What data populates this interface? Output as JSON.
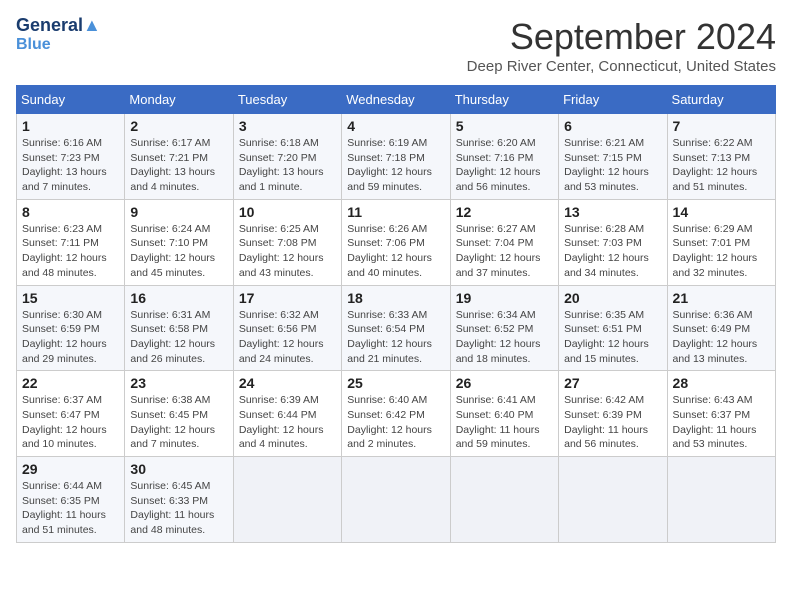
{
  "header": {
    "logo_line1": "General",
    "logo_line2": "Blue",
    "month_title": "September 2024",
    "location": "Deep River Center, Connecticut, United States"
  },
  "weekdays": [
    "Sunday",
    "Monday",
    "Tuesday",
    "Wednesday",
    "Thursday",
    "Friday",
    "Saturday"
  ],
  "weeks": [
    [
      {
        "day": 1,
        "lines": [
          "Sunrise: 6:16 AM",
          "Sunset: 7:23 PM",
          "Daylight: 13 hours",
          "and 7 minutes."
        ]
      },
      {
        "day": 2,
        "lines": [
          "Sunrise: 6:17 AM",
          "Sunset: 7:21 PM",
          "Daylight: 13 hours",
          "and 4 minutes."
        ]
      },
      {
        "day": 3,
        "lines": [
          "Sunrise: 6:18 AM",
          "Sunset: 7:20 PM",
          "Daylight: 13 hours",
          "and 1 minute."
        ]
      },
      {
        "day": 4,
        "lines": [
          "Sunrise: 6:19 AM",
          "Sunset: 7:18 PM",
          "Daylight: 12 hours",
          "and 59 minutes."
        ]
      },
      {
        "day": 5,
        "lines": [
          "Sunrise: 6:20 AM",
          "Sunset: 7:16 PM",
          "Daylight: 12 hours",
          "and 56 minutes."
        ]
      },
      {
        "day": 6,
        "lines": [
          "Sunrise: 6:21 AM",
          "Sunset: 7:15 PM",
          "Daylight: 12 hours",
          "and 53 minutes."
        ]
      },
      {
        "day": 7,
        "lines": [
          "Sunrise: 6:22 AM",
          "Sunset: 7:13 PM",
          "Daylight: 12 hours",
          "and 51 minutes."
        ]
      }
    ],
    [
      {
        "day": 8,
        "lines": [
          "Sunrise: 6:23 AM",
          "Sunset: 7:11 PM",
          "Daylight: 12 hours",
          "and 48 minutes."
        ]
      },
      {
        "day": 9,
        "lines": [
          "Sunrise: 6:24 AM",
          "Sunset: 7:10 PM",
          "Daylight: 12 hours",
          "and 45 minutes."
        ]
      },
      {
        "day": 10,
        "lines": [
          "Sunrise: 6:25 AM",
          "Sunset: 7:08 PM",
          "Daylight: 12 hours",
          "and 43 minutes."
        ]
      },
      {
        "day": 11,
        "lines": [
          "Sunrise: 6:26 AM",
          "Sunset: 7:06 PM",
          "Daylight: 12 hours",
          "and 40 minutes."
        ]
      },
      {
        "day": 12,
        "lines": [
          "Sunrise: 6:27 AM",
          "Sunset: 7:04 PM",
          "Daylight: 12 hours",
          "and 37 minutes."
        ]
      },
      {
        "day": 13,
        "lines": [
          "Sunrise: 6:28 AM",
          "Sunset: 7:03 PM",
          "Daylight: 12 hours",
          "and 34 minutes."
        ]
      },
      {
        "day": 14,
        "lines": [
          "Sunrise: 6:29 AM",
          "Sunset: 7:01 PM",
          "Daylight: 12 hours",
          "and 32 minutes."
        ]
      }
    ],
    [
      {
        "day": 15,
        "lines": [
          "Sunrise: 6:30 AM",
          "Sunset: 6:59 PM",
          "Daylight: 12 hours",
          "and 29 minutes."
        ]
      },
      {
        "day": 16,
        "lines": [
          "Sunrise: 6:31 AM",
          "Sunset: 6:58 PM",
          "Daylight: 12 hours",
          "and 26 minutes."
        ]
      },
      {
        "day": 17,
        "lines": [
          "Sunrise: 6:32 AM",
          "Sunset: 6:56 PM",
          "Daylight: 12 hours",
          "and 24 minutes."
        ]
      },
      {
        "day": 18,
        "lines": [
          "Sunrise: 6:33 AM",
          "Sunset: 6:54 PM",
          "Daylight: 12 hours",
          "and 21 minutes."
        ]
      },
      {
        "day": 19,
        "lines": [
          "Sunrise: 6:34 AM",
          "Sunset: 6:52 PM",
          "Daylight: 12 hours",
          "and 18 minutes."
        ]
      },
      {
        "day": 20,
        "lines": [
          "Sunrise: 6:35 AM",
          "Sunset: 6:51 PM",
          "Daylight: 12 hours",
          "and 15 minutes."
        ]
      },
      {
        "day": 21,
        "lines": [
          "Sunrise: 6:36 AM",
          "Sunset: 6:49 PM",
          "Daylight: 12 hours",
          "and 13 minutes."
        ]
      }
    ],
    [
      {
        "day": 22,
        "lines": [
          "Sunrise: 6:37 AM",
          "Sunset: 6:47 PM",
          "Daylight: 12 hours",
          "and 10 minutes."
        ]
      },
      {
        "day": 23,
        "lines": [
          "Sunrise: 6:38 AM",
          "Sunset: 6:45 PM",
          "Daylight: 12 hours",
          "and 7 minutes."
        ]
      },
      {
        "day": 24,
        "lines": [
          "Sunrise: 6:39 AM",
          "Sunset: 6:44 PM",
          "Daylight: 12 hours",
          "and 4 minutes."
        ]
      },
      {
        "day": 25,
        "lines": [
          "Sunrise: 6:40 AM",
          "Sunset: 6:42 PM",
          "Daylight: 12 hours",
          "and 2 minutes."
        ]
      },
      {
        "day": 26,
        "lines": [
          "Sunrise: 6:41 AM",
          "Sunset: 6:40 PM",
          "Daylight: 11 hours",
          "and 59 minutes."
        ]
      },
      {
        "day": 27,
        "lines": [
          "Sunrise: 6:42 AM",
          "Sunset: 6:39 PM",
          "Daylight: 11 hours",
          "and 56 minutes."
        ]
      },
      {
        "day": 28,
        "lines": [
          "Sunrise: 6:43 AM",
          "Sunset: 6:37 PM",
          "Daylight: 11 hours",
          "and 53 minutes."
        ]
      }
    ],
    [
      {
        "day": 29,
        "lines": [
          "Sunrise: 6:44 AM",
          "Sunset: 6:35 PM",
          "Daylight: 11 hours",
          "and 51 minutes."
        ]
      },
      {
        "day": 30,
        "lines": [
          "Sunrise: 6:45 AM",
          "Sunset: 6:33 PM",
          "Daylight: 11 hours",
          "and 48 minutes."
        ]
      },
      null,
      null,
      null,
      null,
      null
    ]
  ]
}
